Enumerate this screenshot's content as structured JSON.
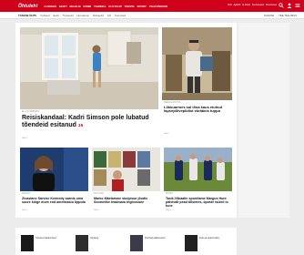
{
  "header": {
    "logo": "Õhtuleht",
    "nav": [
      "UUDISED",
      "EESTI",
      "MAAILM",
      "KRIMI",
      "TEHNIKA",
      "KULTUUR",
      "TERVIS",
      "SPORT",
      "TELEVISIOON"
    ],
    "utility": [
      "Telli",
      "Ajaleht",
      "E-kiosk",
      "Kuulutused",
      "Kinnisvara"
    ],
    "accent_color": "#d0021b",
    "icons": [
      "search-icon",
      "user-icon",
      "menu-icon"
    ]
  },
  "subnav": {
    "items": [
      "TÄNASE ÕHTU",
      "Uudised",
      "Eesti",
      "TV-kavad",
      "Horoskoop",
      "Retseptid",
      "Abi",
      "Teenused"
    ],
    "right": [
      "OÜKATE",
      "TEE TELLIMUS"
    ]
  },
  "articles": [
    {
      "headline": "Reisiskandaal: Kadri Simson pole lubatud tõendeid esitanud",
      "badge": "15",
      "category": "ELU JA INIMESED",
      "time": "MÄLU"
    },
    {
      "headline": "Lõkkuarmes sai lõna kaus eluhud lapsepõlvepildist ekräänis tuppa",
      "category": "MEELELAHUTUS",
      "time": "MÄLU"
    },
    {
      "headline": "Zivastane Sarvise Kennedy saanis oma suure köige mom end ametslastu õppida",
      "category": "MAAILM",
      "time": "MÄLU"
    },
    {
      "headline": "Marko Mäetamme skulptuur jõudis Soomelike teadmata trigilosoole",
      "category": "KULTUUR",
      "time": "MÄLU"
    },
    {
      "headline": "Tardi-Võkaalin spordiame Margus Hunt pälvivalt pead tõlsimes, öpuste tsüleli lo tune",
      "category": "SPORT",
      "time": "MÄLU"
    }
  ],
  "bottom_strip": [
    {
      "text": "Tänased pakkumised"
    },
    {
      "text": "Ostuaeg"
    },
    {
      "text": "Parimad pakkumised"
    },
    {
      "text": "Kodu ja elektroonika"
    }
  ]
}
